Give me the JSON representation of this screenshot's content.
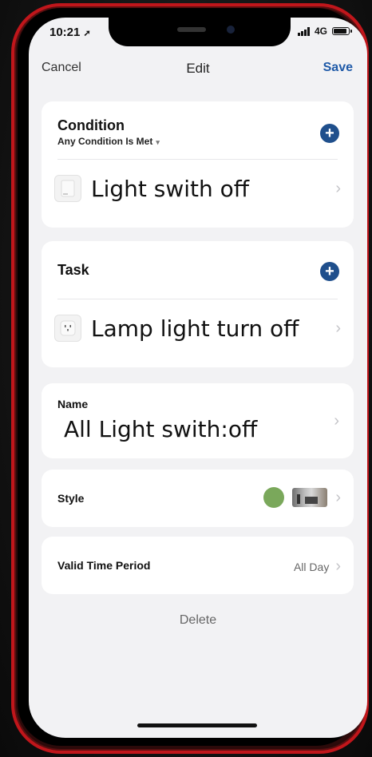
{
  "status": {
    "time": "10:21",
    "network": "4G"
  },
  "nav": {
    "cancel": "Cancel",
    "title": "Edit",
    "save": "Save"
  },
  "condition": {
    "title": "Condition",
    "mode": "Any Condition Is Met",
    "item_label": "Light swith off"
  },
  "task": {
    "title": "Task",
    "item_label": "Lamp light turn off"
  },
  "name": {
    "label": "Name",
    "value": "All Light swith:off"
  },
  "style": {
    "label": "Style",
    "color": "#7aa85b"
  },
  "valid_time": {
    "label": "Valid Time Period",
    "value": "All Day"
  },
  "delete_label": "Delete",
  "colors": {
    "accent": "#1f5aa8",
    "add_button": "#1f4f8c",
    "frame": "#c0161b"
  }
}
